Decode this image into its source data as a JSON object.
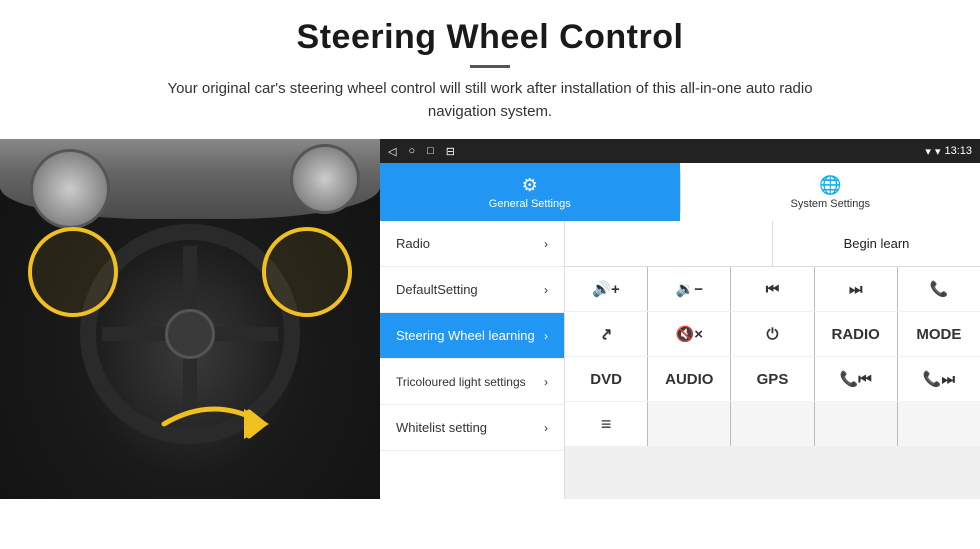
{
  "header": {
    "title": "Steering Wheel Control",
    "description": "Your original car's steering wheel control will still work after installation of this all-in-one auto radio navigation system."
  },
  "statusBar": {
    "time": "13:13",
    "icons": [
      "◁",
      "○",
      "□",
      "⊟"
    ]
  },
  "tabs": [
    {
      "id": "general",
      "label": "General Settings",
      "icon": "⚙",
      "active": true
    },
    {
      "id": "system",
      "label": "System Settings",
      "icon": "🌐",
      "active": false
    }
  ],
  "menuItems": [
    {
      "id": "radio",
      "label": "Radio",
      "active": false
    },
    {
      "id": "default",
      "label": "DefaultSetting",
      "active": false
    },
    {
      "id": "steering",
      "label": "Steering Wheel learning",
      "active": true
    },
    {
      "id": "tricoloured",
      "label": "Tricoloured light settings",
      "active": false
    },
    {
      "id": "whitelist",
      "label": "Whitelist setting",
      "active": false
    }
  ],
  "beginLearnBtn": "Begin learn",
  "controlRows": [
    [
      {
        "id": "vol-up",
        "label": "🔊+",
        "type": "icon"
      },
      {
        "id": "vol-down",
        "label": "🔉−",
        "type": "icon"
      },
      {
        "id": "prev-track",
        "label": "⏮",
        "type": "icon"
      },
      {
        "id": "next-track",
        "label": "⏭",
        "type": "icon"
      },
      {
        "id": "phone",
        "label": "📞",
        "type": "icon"
      }
    ],
    [
      {
        "id": "hang-up",
        "label": "↩",
        "type": "icon"
      },
      {
        "id": "mute",
        "label": "🔇×",
        "type": "icon"
      },
      {
        "id": "power",
        "label": "⏻",
        "type": "icon"
      },
      {
        "id": "radio-btn",
        "label": "RADIO",
        "type": "text"
      },
      {
        "id": "mode-btn",
        "label": "MODE",
        "type": "text"
      }
    ],
    [
      {
        "id": "dvd-btn",
        "label": "DVD",
        "type": "text"
      },
      {
        "id": "audio-btn",
        "label": "AUDIO",
        "type": "text"
      },
      {
        "id": "gps-btn",
        "label": "GPS",
        "type": "text"
      },
      {
        "id": "phone-prev",
        "label": "📞⏮",
        "type": "icon"
      },
      {
        "id": "phone-next",
        "label": "📞⏭",
        "type": "icon"
      }
    ],
    [
      {
        "id": "list-btn",
        "label": "≡",
        "type": "icon"
      }
    ]
  ]
}
